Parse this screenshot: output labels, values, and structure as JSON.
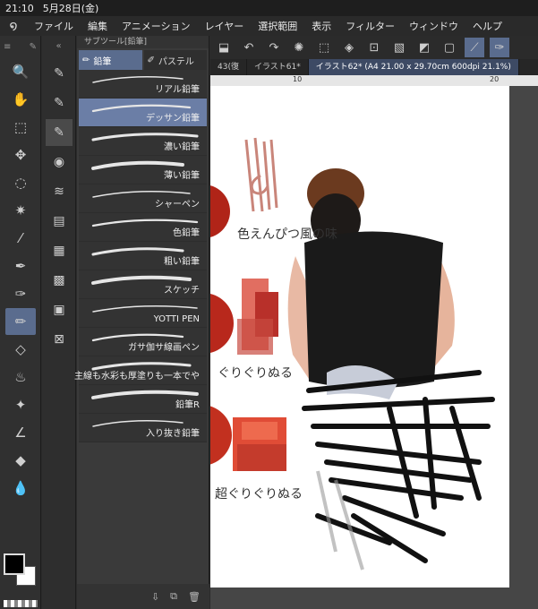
{
  "status": {
    "time": "21:10",
    "date": "5月28日(金)"
  },
  "menu": [
    "ファイル",
    "編集",
    "アニメーション",
    "レイヤー",
    "選択範囲",
    "表示",
    "フィルター",
    "ウィンドウ",
    "ヘルプ"
  ],
  "subtool": {
    "title": "サブツール[鉛筆]",
    "tabs": [
      {
        "label": "鉛筆"
      },
      {
        "label": "パステル"
      }
    ],
    "brushes": [
      "リアル鉛筆",
      "デッサン鉛筆",
      "濃い鉛筆",
      "薄い鉛筆",
      "シャーペン",
      "色鉛筆",
      "粗い鉛筆",
      "スケッチ",
      "YOTTI PEN",
      "ガサ伽サ線画ペン",
      "主線も水彩も厚塗りも一本でや",
      "鉛筆R",
      "入り抜き鉛筆"
    ],
    "selected_index": 1
  },
  "tabs": [
    {
      "label": "43(復"
    },
    {
      "label": "イラスト61*"
    },
    {
      "label": "イラスト62* (A4 21.00 x 29.70cm 600dpi 21.1%)"
    }
  ],
  "ruler": {
    "marks": [
      "10",
      "20"
    ]
  },
  "annotations": {
    "a1": "色えんぴつ風の味",
    "a2": "ぐりぐりぬる",
    "a3": "超ぐりぐりぬる"
  },
  "colors": {
    "accent": "#5a6c8e",
    "selected_brush": "#6b7ea6"
  }
}
